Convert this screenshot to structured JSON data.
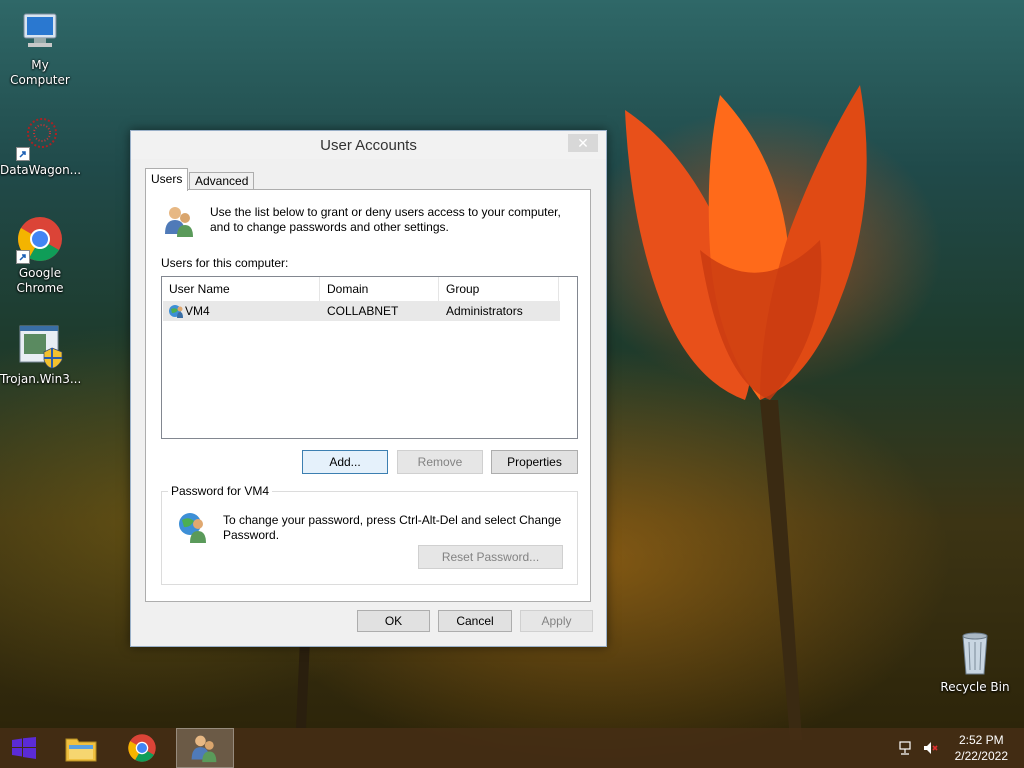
{
  "desktop": {
    "icons": [
      {
        "label": "My Computer",
        "icon": "computer-icon"
      },
      {
        "label": "DataWagon...",
        "icon": "datawagon-icon"
      },
      {
        "label": "Google Chrome",
        "icon": "chrome-icon"
      },
      {
        "label": "Trojan.Win3...",
        "icon": "installer-icon"
      },
      {
        "label": "Recycle Bin",
        "icon": "recycle-bin-icon"
      }
    ]
  },
  "dialog": {
    "title": "User Accounts",
    "close_glyph": "✕",
    "tabs": [
      "Users",
      "Advanced"
    ],
    "intro": "Use the list below to grant or deny users access to your computer, and to change passwords and other settings.",
    "users_label": "Users for this computer:",
    "columns": [
      "User Name",
      "Domain",
      "Group"
    ],
    "rows": [
      {
        "name": "VM4",
        "domain": "COLLABNET",
        "group": "Administrators"
      }
    ],
    "buttons": {
      "add": "Add...",
      "remove": "Remove",
      "properties": "Properties"
    },
    "password_group_title": "Password for VM4",
    "password_text": "To change your password, press Ctrl-Alt-Del and select Change Password.",
    "reset_password": "Reset Password...",
    "footer": {
      "ok": "OK",
      "cancel": "Cancel",
      "apply": "Apply"
    }
  },
  "taskbar": {
    "items": [
      "start-icon",
      "file-explorer-icon",
      "chrome-icon",
      "user-accounts-icon"
    ],
    "time": "2:52 PM",
    "date": "2/22/2022"
  }
}
